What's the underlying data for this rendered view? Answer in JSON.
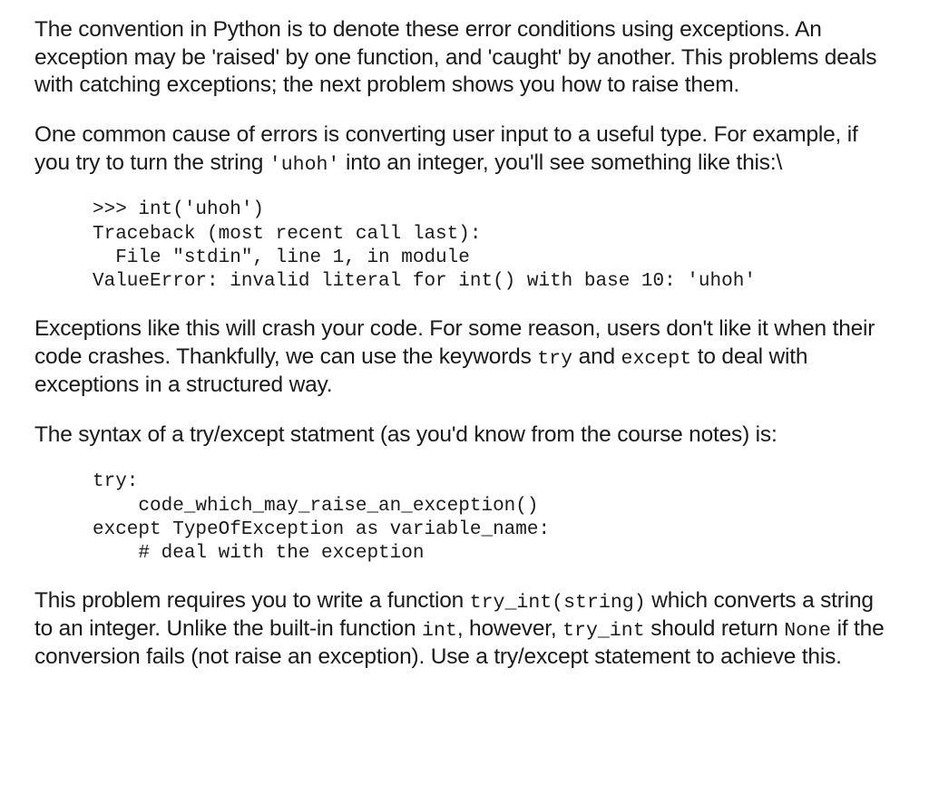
{
  "para1_a": "The convention in Python is to denote these error conditions using exceptions. An exception may be 'raised' by one function, and 'caught' by another. This problems deals with catching exceptions; the next problem shows you how to raise them.",
  "para2_a": "One common cause of errors is converting user input to a useful type. For example, if you try to turn the string ",
  "para2_code": "'uhoh'",
  "para2_b": " into an integer, you'll see something like this:\\",
  "code1": ">>> int('uhoh')\nTraceback (most recent call last):\n  File \"stdin\", line 1, in module\nValueError: invalid literal for int() with base 10: 'uhoh'",
  "para3_a": "Exceptions like this will crash your code. For some reason, users don't like it when their code crashes. Thankfully, we can use the keywords ",
  "para3_code1": "try",
  "para3_b": " and ",
  "para3_code2": "except",
  "para3_c": " to deal with exceptions in a structured way.",
  "para4_a": "The syntax of a try/except statment (as you'd know from the course notes) is:",
  "code2": "try:\n    code_which_may_raise_an_exception()\nexcept TypeOfException as variable_name:\n    # deal with the exception",
  "para5_a": "This problem requires you to write a function ",
  "para5_code1": "try_int(string)",
  "para5_b": " which converts a string to an integer. Unlike the built-in function ",
  "para5_code2": "int",
  "para5_c": ", however, ",
  "para5_code3": "try_int",
  "para5_d": " should return ",
  "para5_code4": "None",
  "para5_e": " if the conversion fails (not raise an exception). Use a try/except statement to achieve this."
}
